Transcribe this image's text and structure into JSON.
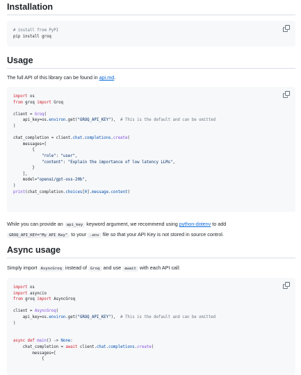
{
  "sections": {
    "installation": {
      "heading": "Installation"
    },
    "usage": {
      "heading": "Usage",
      "intro_text": "The full API of this library can be found in ",
      "intro_link": "api.md",
      "intro_end": "."
    },
    "keyword_note": {
      "t1": "While you can provide an ",
      "code1": "api_key",
      "t2": " keyword argument, we recommend using ",
      "link": "python-dotenv",
      "t3": " to add",
      "code2": "GROQ_API_KEY=\"My API Key\"",
      "t4": " to your ",
      "code3": ".env",
      "t5": " file so that your API Key is not stored in source control."
    },
    "async_usage": {
      "heading": "Async usage",
      "t1": "Simply import ",
      "code1": "AsyncGroq",
      "t2": " instead of ",
      "code2": "Groq",
      "t3": " and use ",
      "code3": "await",
      "t4": " with each API call:"
    }
  },
  "code": {
    "install": {
      "comment": "# install from PyPI",
      "cmd": "pip install groq"
    },
    "usage": {
      "l_import_os_kw": "import",
      "l_import_os_mod": " os",
      "l_from_kw": "from",
      "l_from_mod": " groq ",
      "l_from_import": "import",
      "l_from_name": " Groq",
      "client_pre": "client = ",
      "client_fn": "Groq",
      "client_post": "(",
      "apikey_pre": "    api_key=os.",
      "apikey_env": "environ",
      "apikey_get": ".get(",
      "apikey_str": "\"GROQ_API_KEY\"",
      "apikey_post": "),  ",
      "apikey_comment": "# This is the default and can be omitted",
      "close": ")",
      "cc_pre": "chat_completion = client.",
      "cc_chat": "chat",
      "cc_dot1": ".",
      "cc_completions": "completions",
      "cc_dot2": ".",
      "cc_create": "create",
      "cc_post": "(",
      "messages": "    messages=[",
      "brace_open": "        {",
      "role_key": "            \"role\"",
      "role_sep": ": ",
      "role_val": "\"user\"",
      "role_end": ",",
      "content_key": "            \"content\"",
      "content_sep": ": ",
      "content_val": "\"Explain the importance of low latency LLMs\"",
      "content_end": ",",
      "brace_close": "        }",
      "list_close": "    ],",
      "model_pre": "    model=",
      "model_val": "\"openai/gpt-oss-20b\"",
      "model_end": ",",
      "close2": ")",
      "print_fn": "print",
      "print_args": "(chat_completion.",
      "print_choices": "choices",
      "print_idx": "[",
      "print_zero": "0",
      "print_idx_end": "].",
      "print_message": "message",
      "print_dot": ".",
      "print_content": "content",
      "print_end": ")"
    },
    "async": {
      "l1_kw": "import",
      "l1_mod": " os",
      "l2_kw": "import",
      "l2_mod": " asyncio",
      "l3_kw": "from",
      "l3_mod": " groq ",
      "l3_kw2": "import",
      "l3_name": " AsyncGroq",
      "client_pre": "client = ",
      "client_fn": "AsyncGroq",
      "client_post": "(",
      "apikey_pre": "    api_key=os.",
      "apikey_env": "environ",
      "apikey_get": ".get(",
      "apikey_str": "\"GROQ_API_KEY\"",
      "apikey_post": "),  ",
      "apikey_comment": "# This is the default and can be omitted",
      "close": ")",
      "def_kw": "async def",
      "def_name": " main",
      "def_post": "() -> ",
      "def_ret": "None",
      "def_colon": ":",
      "cc_pre": "    chat_completion = ",
      "cc_await": "await",
      "cc_client": " client.",
      "cc_chat": "chat",
      "cc_dot1": ".",
      "cc_completions": "completions",
      "cc_dot2": ".",
      "cc_create": "create",
      "cc_post": "(",
      "messages": "        messages=[",
      "brace_open": "            {"
    }
  },
  "icons": {
    "copy": "copy-icon"
  },
  "colors": {
    "link": "#0969da",
    "keyword": "#cf222e",
    "string": "#0a3069",
    "comment": "#6e7781",
    "function": "#8250df"
  }
}
